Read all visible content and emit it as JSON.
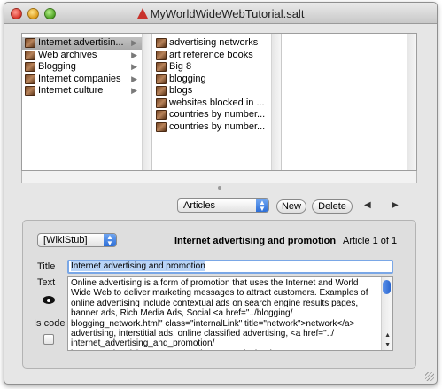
{
  "window": {
    "title": "MyWorldWideWebTutorial.salt"
  },
  "browser": {
    "column1": [
      {
        "label": "Internet advertisin...",
        "selected": true
      },
      {
        "label": "Web archives",
        "selected": false
      },
      {
        "label": "Blogging",
        "selected": false
      },
      {
        "label": "Internet companies",
        "selected": false
      },
      {
        "label": "Internet culture",
        "selected": false
      }
    ],
    "column2": [
      "advertising networks",
      "art reference books",
      "Big 8",
      "blogging",
      "blogs",
      "websites blocked in ...",
      "countries by number...",
      "countries by number..."
    ]
  },
  "toolbar": {
    "type_select": "Articles",
    "new_label": "New",
    "delete_label": "Delete",
    "prev_icon": "left-triangle-icon",
    "next_icon": "right-triangle-icon"
  },
  "editor": {
    "template_select": "[WikiStub]",
    "heading": "Internet advertising and promotion",
    "counter": "Article 1 of 1",
    "title_label": "Title",
    "title_value": "Internet advertising and promotion",
    "text_label": "Text",
    "text_value": "Online advertising is a form of promotion that uses the Internet and World\nWide Web to deliver marketing messages to attract customers. Examples of\nonline advertising include contextual ads on search engine results pages,\nbanner ads, Rich Media Ads, Social <a href=\"../blogging/\nblogging_network.html\" class=\"internalLink\" title=\"network\">network</a>\nadvertising, interstitial ads, online classified advertising, <a href=\"../\ninternet_advertising_and_promotion/\ninternet_advertising_and_promotion_networks.html\"",
    "iscode_label": "Is code",
    "iscode_checked": false
  },
  "colors": {
    "selection": "#b9d4f7",
    "accent": "#2d6fd8",
    "row_selected": "#b5b5b5"
  }
}
